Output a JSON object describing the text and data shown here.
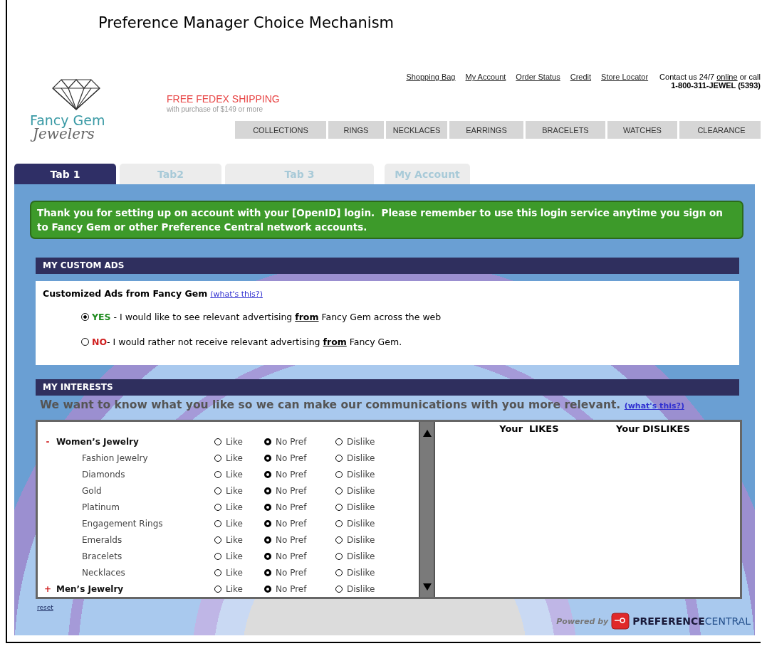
{
  "slide_title": "Preference Manager Choice Mechanism",
  "logo": {
    "line_1": "Fancy Gem",
    "line_2": "Jewelers"
  },
  "promo": {
    "headline": "FREE FEDEX SHIPPING",
    "subline": "with purchase of $149 or more"
  },
  "top_links": [
    "Shopping Bag",
    "My Account",
    "Order Status",
    "Credit",
    "Store Locator"
  ],
  "contact": {
    "text_before": "Contact us 24/7",
    "link": "online",
    "text_after": "or call",
    "phone": "1-800-311-JEWEL (5393)"
  },
  "nav": [
    "COLLECTIONS",
    "RINGS",
    "NECKLACES",
    "EARRINGS",
    "BRACELETS",
    "WATCHES",
    "CLEARANCE"
  ],
  "tabs": [
    {
      "label": "Tab 1",
      "selected": true
    },
    {
      "label": "Tab2",
      "selected": false
    },
    {
      "label": "Tab 3",
      "selected": false
    },
    {
      "label": "My Account",
      "selected": false
    }
  ],
  "banner": "Thank you for setting up on account with your [OpenID] login.  Please remember to use this login service anytime you sign on to Fancy Gem or other Preference Central network accounts.",
  "custom_ads": {
    "header": "MY CUSTOM ADS",
    "title": "Customized Ads from Fancy Gem",
    "help_link": "(what's this?)",
    "options": [
      {
        "kind": "yes",
        "answer": "YES",
        "text": " - I would like to see relevant advertising **from** Fancy Gem across the web",
        "selected": true
      },
      {
        "kind": "no",
        "answer": "NO",
        "text": "- I would rather not receive relevant advertising **from** Fancy Gem.",
        "selected": false
      }
    ]
  },
  "interests": {
    "header": "MY INTERESTS",
    "intro": "We want to know what you like so we can make our communications with you more relevant.",
    "help_link": "(what's this?)",
    "categories": [
      {
        "toggle": "-",
        "name": "Women’s Jewelry",
        "options": [
          {
            "label": "Like",
            "selected": false
          },
          {
            "label": "No Pref",
            "selected": true
          },
          {
            "label": "Dislike",
            "selected": false
          }
        ],
        "children": [
          {
            "name": "Fashion Jewelry",
            "options": [
              {
                "label": "Like",
                "selected": false
              },
              {
                "label": "No Pref",
                "selected": true
              },
              {
                "label": "Dislike",
                "selected": false
              }
            ]
          },
          {
            "name": "Diamonds",
            "options": [
              {
                "label": "Like",
                "selected": false
              },
              {
                "label": "No Pref",
                "selected": true
              },
              {
                "label": "Dislike",
                "selected": false
              }
            ]
          },
          {
            "name": "Gold",
            "options": [
              {
                "label": "Like",
                "selected": false
              },
              {
                "label": "No Pref",
                "selected": true
              },
              {
                "label": "Dislike",
                "selected": false
              }
            ]
          },
          {
            "name": "Platinum",
            "options": [
              {
                "label": "Like",
                "selected": false
              },
              {
                "label": "No Pref",
                "selected": true
              },
              {
                "label": "Dislike",
                "selected": false
              }
            ]
          },
          {
            "name": "Engagement Rings",
            "options": [
              {
                "label": "Like",
                "selected": false
              },
              {
                "label": "No Pref",
                "selected": true
              },
              {
                "label": "Dislike",
                "selected": false
              }
            ]
          },
          {
            "name": "Emeralds",
            "options": [
              {
                "label": "Like",
                "selected": false
              },
              {
                "label": "No Pref",
                "selected": true
              },
              {
                "label": "Dislike",
                "selected": false
              }
            ]
          },
          {
            "name": "Bracelets",
            "options": [
              {
                "label": "Like",
                "selected": false
              },
              {
                "label": "No Pref",
                "selected": true
              },
              {
                "label": "Dislike",
                "selected": false
              }
            ]
          },
          {
            "name": "Necklaces",
            "options": [
              {
                "label": "Like",
                "selected": false
              },
              {
                "label": "No Pref",
                "selected": true
              },
              {
                "label": "Dislike",
                "selected": false
              }
            ]
          }
        ]
      },
      {
        "toggle": "+",
        "name": "Men’s Jewelry",
        "options": [
          {
            "label": "Like",
            "selected": false
          },
          {
            "label": "No Pref",
            "selected": true
          },
          {
            "label": "Dislike",
            "selected": false
          }
        ]
      }
    ],
    "likes_heading": "Your  LIKES",
    "dislikes_heading": "Your DISLIKES",
    "reset": "reset"
  },
  "powered_by": {
    "label": "Powered by",
    "brand_1": "PREFERENCE",
    "brand_2": "CENTRAL"
  }
}
